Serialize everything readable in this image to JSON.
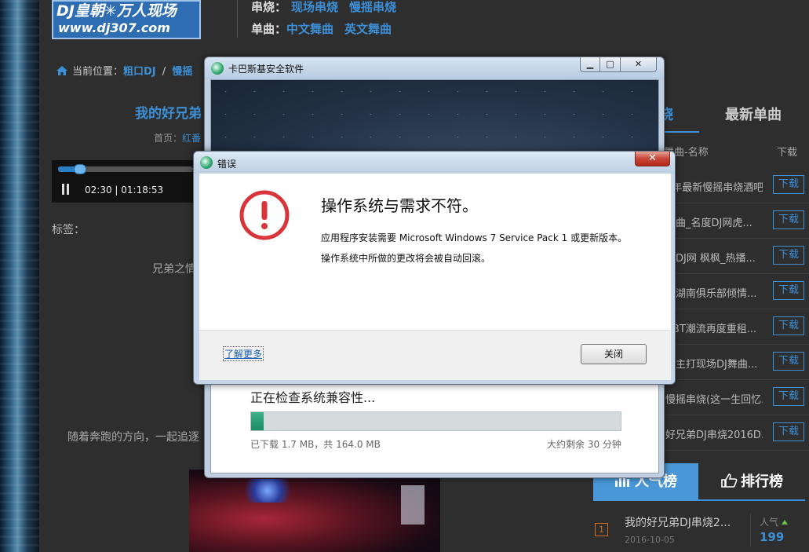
{
  "site": {
    "logo_line1": "DJ皇朝✳万人现场",
    "logo_line2": "www.dj307.com",
    "nav_row1_label": "串烧：",
    "nav_row1_links": [
      "现场串烧",
      "慢摇串烧"
    ],
    "nav_row2_label": "单曲：",
    "nav_row2_links": [
      "中文舞曲",
      "英文舞曲"
    ],
    "breadcrumb": {
      "prefix": "当前位置：",
      "crumb1": "粗口DJ",
      "sep": "/",
      "crumb2": "慢摇"
    },
    "song_title": "我的好兄弟",
    "home_line": {
      "label": "首页：",
      "link": "红番"
    },
    "player": {
      "time": "02:30 | 01:18:53"
    },
    "tags_label": "标签：",
    "lyric_1": "兄弟之情",
    "lyric_2": "随着奔跑的方向，一起追逐"
  },
  "right_panel": {
    "tab_hot": "烧",
    "tab_new": "最新单曲",
    "col_name": "舞曲-名称",
    "col_download": "下载",
    "songs": [
      {
        "name": "2年最新慢摇串烧酒吧...",
        "download": "下载"
      },
      {
        "name": "舞曲_名度DJ网虎...",
        "download": "下载"
      },
      {
        "name": "乐DJ网 枫枫_热播...",
        "download": "下载"
      },
      {
        "name": "月湖南俱乐部倾情...",
        "download": "下载"
      },
      {
        "name": "BBT潮流再度重租...",
        "download": "下载"
      },
      {
        "name": "新主打现场DJ舞曲...",
        "download": "下载"
      },
      {
        "name": "慢摇串烧(这一生回忆...",
        "download": "下载"
      },
      {
        "name": "好兄弟DJ串烧2016D...",
        "download": "下载"
      }
    ],
    "pop_tab": "人气榜",
    "rank_tab": "排行榜",
    "rank_item": {
      "num": "1",
      "title": "我的好兄弟DJ串烧2...",
      "date": "2016-10-05",
      "pop_label": "人气",
      "pop_value": "199"
    }
  },
  "installer": {
    "title": "卡巴斯基安全软件",
    "min": "▁",
    "max": "□",
    "close": "✕",
    "status": "正在检查系统兼容性...",
    "progress": 0.035,
    "downloaded": "已下载 1.7 MB，共 164.0 MB",
    "remaining": "大约剩余 30 分钟"
  },
  "error_dialog": {
    "title": "错误",
    "close": "✕",
    "heading": "操作系统与需求不符。",
    "message1": "应用程序安装需要 Microsoft Windows 7 Service Pack 1 或更新版本。",
    "message2": "操作系统中所做的更改将会被自动回滚。",
    "learn_more": "了解更多",
    "close_button": "关闭"
  },
  "colors": {
    "accent": "#3d8fd6",
    "error_red": "#d8343a",
    "progress_green": "#1c8a66"
  }
}
